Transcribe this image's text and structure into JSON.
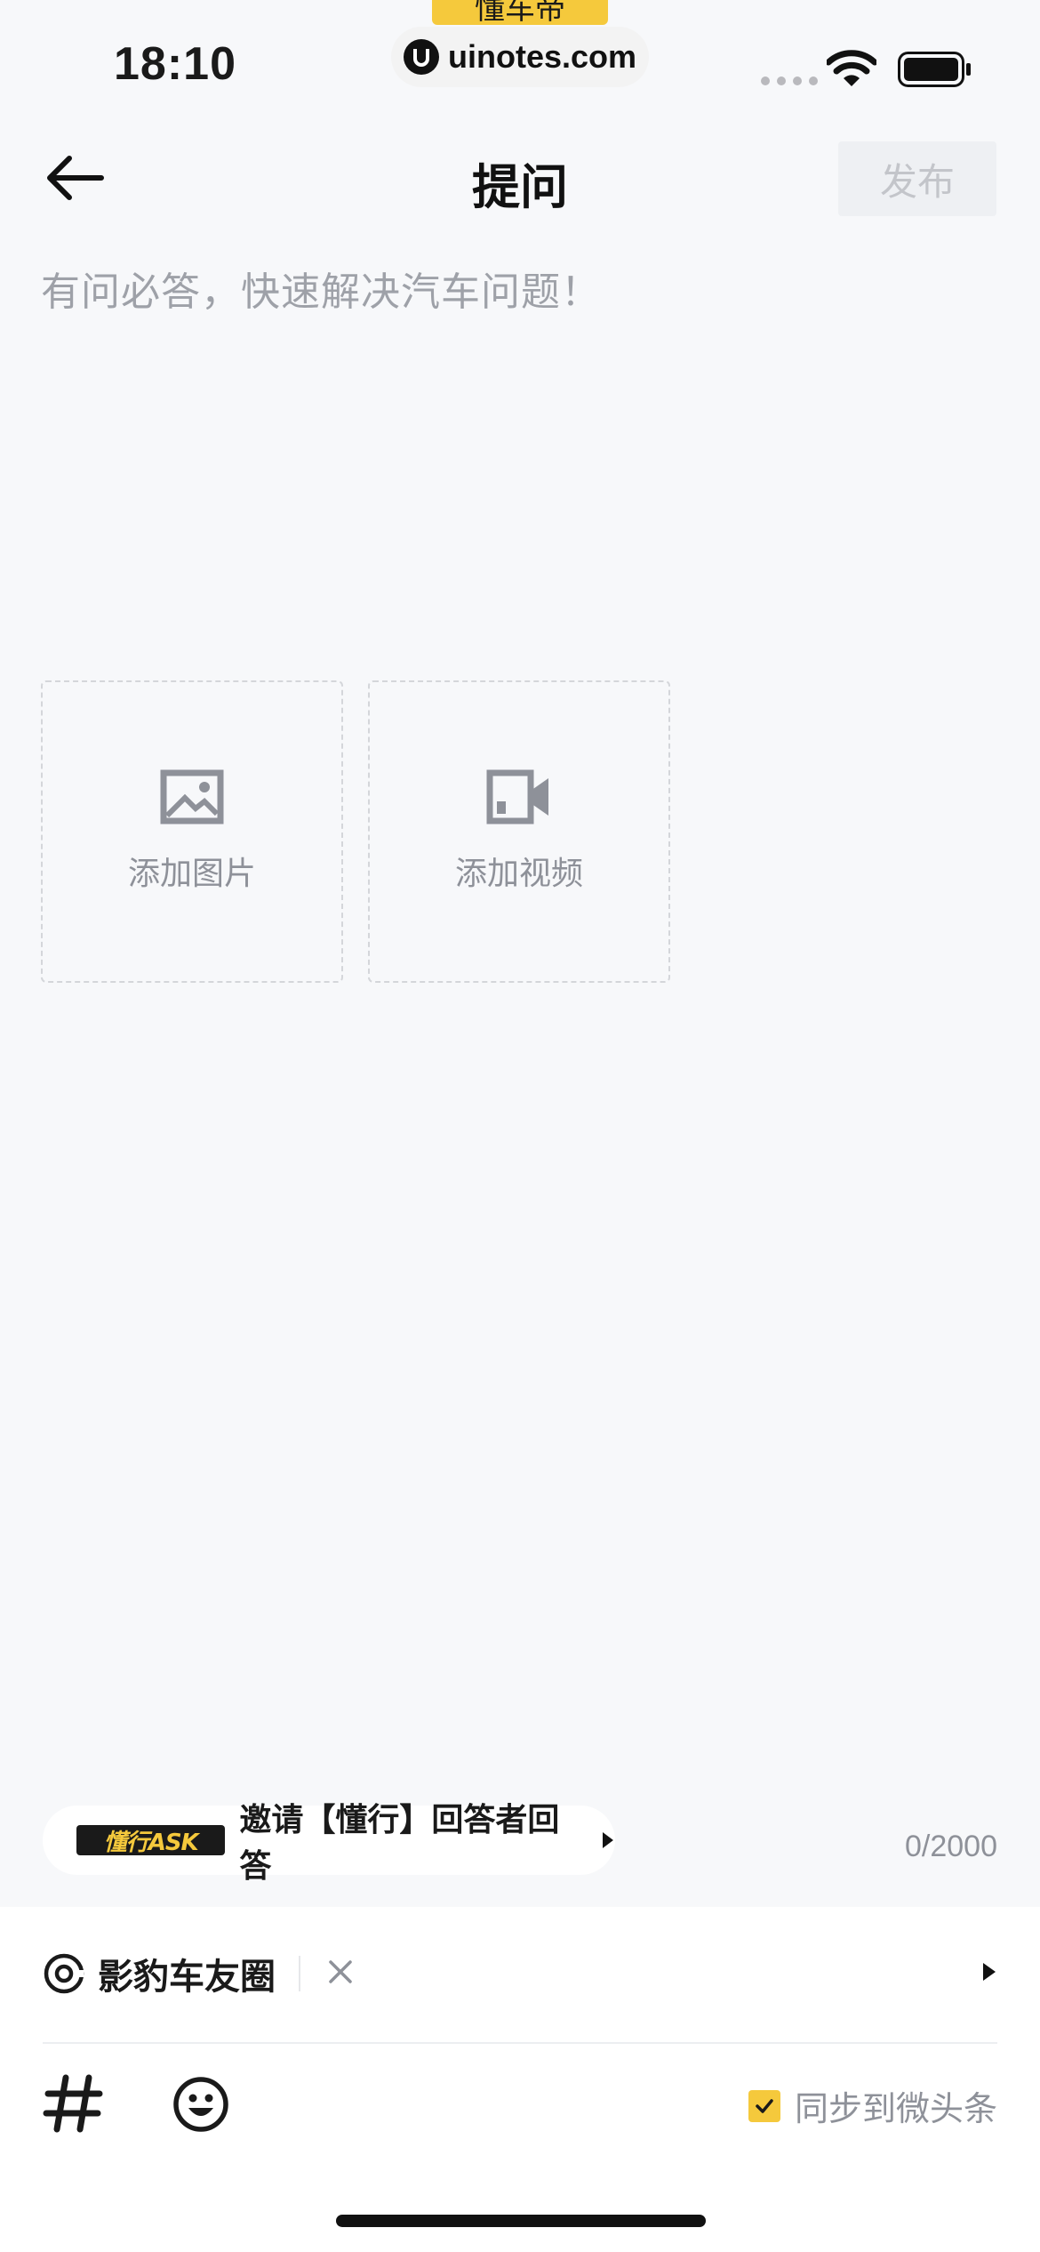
{
  "status_bar": {
    "time": "18:10",
    "brand_tab": "懂车帝",
    "url": "uinotes.com"
  },
  "nav": {
    "title": "提问",
    "publish_label": "发布"
  },
  "question": {
    "placeholder": "有问必答，快速解决汽车问题！",
    "char_count": "0/2000"
  },
  "media": {
    "add_image_label": "添加图片",
    "add_video_label": "添加视频"
  },
  "ask_banner": {
    "logo_text": "懂行ASK",
    "text": "邀请【懂行】回答者回答"
  },
  "circle": {
    "name": "影豹车友圈"
  },
  "sync": {
    "label": "同步到微头条",
    "checked": true
  },
  "colors": {
    "accent": "#f5c93c",
    "background": "#f7f8fa",
    "disabled_text": "#c3c5ca",
    "secondary_text": "#8e9199"
  }
}
